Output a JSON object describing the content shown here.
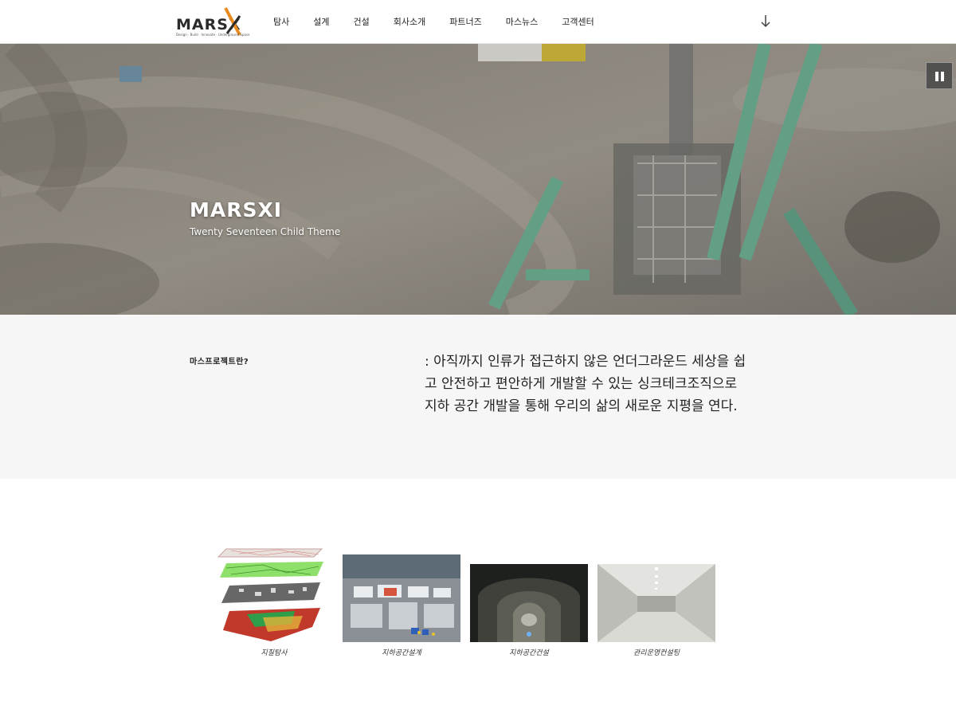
{
  "header": {
    "logo_text": "MARSX",
    "logo_tagline": "Design · Build · Innovate · Underground Space",
    "nav": [
      "탐사",
      "설계",
      "건설",
      "회사소개",
      "파트너즈",
      "마스뉴스",
      "고객센터"
    ],
    "accent_color": "#e98a1f"
  },
  "hero": {
    "title": "MARSXI",
    "subtitle": "Twenty Seventeen Child Theme",
    "pause_icon": "pause-icon"
  },
  "intro": {
    "label": "마스프로젝트란?",
    "text": ": 아직까지 인류가 접근하지 않은 언더그라운드 세상을 쉽고 안전하고 편안하게 개발할 수 있는 싱크테크조직으로 지하 공간 개발을 통해 우리의 삶의 새로운 지평을 연다."
  },
  "gallery": {
    "items": [
      {
        "caption": "지질탐사"
      },
      {
        "caption": "지하공간설계"
      },
      {
        "caption": "지하공간건설"
      },
      {
        "caption": "관리운영컨설팅"
      }
    ]
  }
}
